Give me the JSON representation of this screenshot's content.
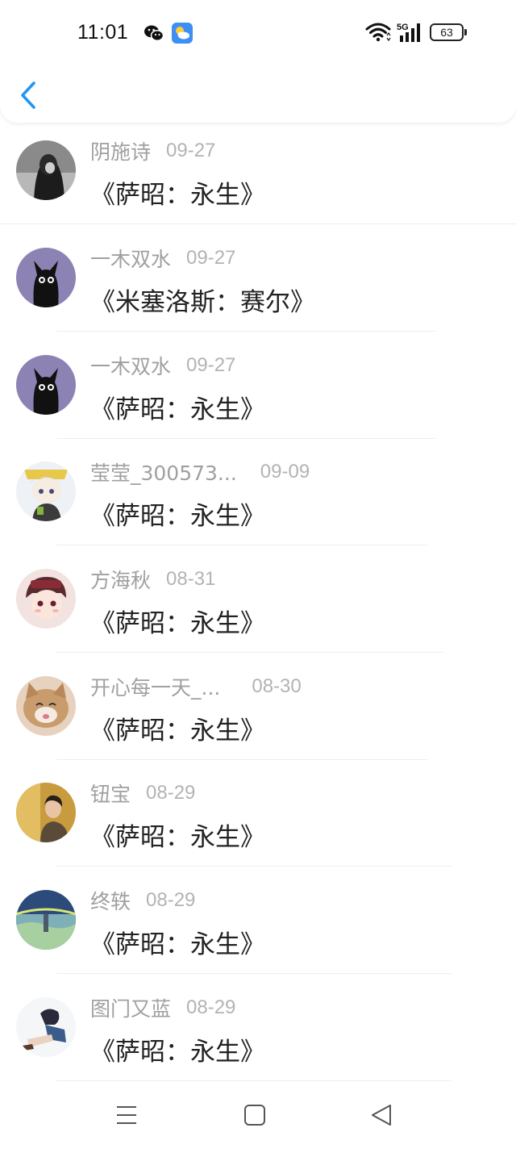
{
  "status_bar": {
    "time": "11:01",
    "battery": "63",
    "network": "5G",
    "icons": [
      "wechat-icon",
      "weather-icon",
      "wifi-icon",
      "signal-icon",
      "battery-icon"
    ]
  },
  "header": {
    "back_icon": "chevron-left-icon",
    "accent_color": "#2196f3"
  },
  "items": [
    {
      "name": "阴施诗",
      "date": "09-27",
      "title": "《萨昭：永生》"
    },
    {
      "name": "一木双水",
      "date": "09-27",
      "title": "《米塞洛斯：赛尔》"
    },
    {
      "name": "一木双水",
      "date": "09-27",
      "title": "《萨昭：永生》"
    },
    {
      "name": "莹莹_300573...",
      "date": "09-09",
      "title": "《萨昭：永生》"
    },
    {
      "name": "方海秋",
      "date": "08-31",
      "title": "《萨昭：永生》"
    },
    {
      "name": "开心每一天_...",
      "date": "08-30",
      "title": "《萨昭：永生》"
    },
    {
      "name": "钮宝",
      "date": "08-29",
      "title": "《萨昭：永生》"
    },
    {
      "name": "终轶",
      "date": "08-29",
      "title": "《萨昭：永生》"
    },
    {
      "name": "图门又蓝",
      "date": "08-29",
      "title": "《萨昭：永生》"
    }
  ],
  "nav_bar": {
    "icons": [
      "menu-icon",
      "home-square-icon",
      "back-triangle-icon"
    ]
  }
}
